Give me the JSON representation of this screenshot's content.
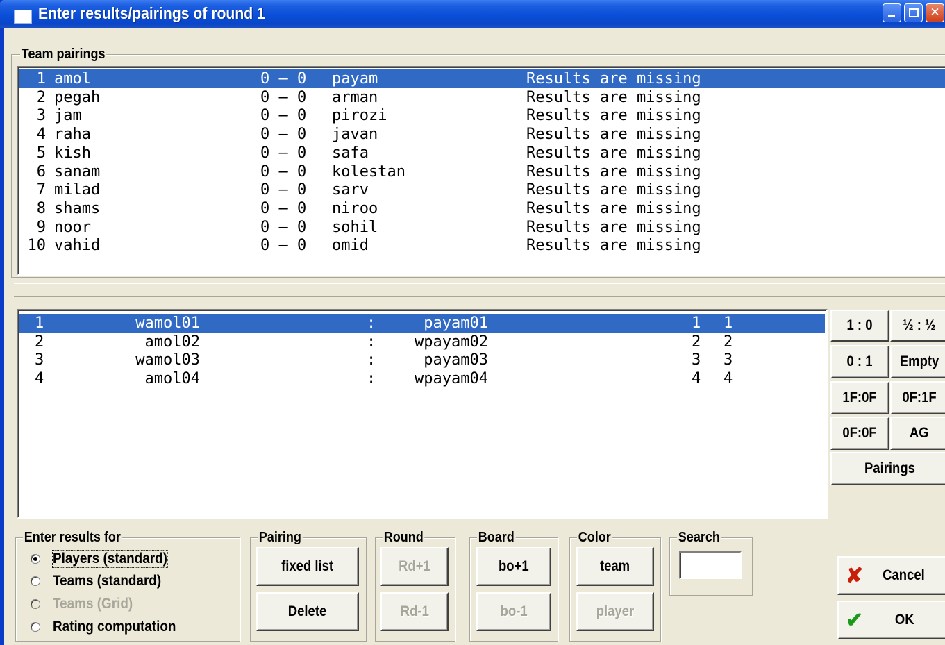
{
  "window": {
    "title": "Enter results/pairings of round 1"
  },
  "team_pairings": {
    "label": "Team pairings",
    "rows": [
      {
        "no": "1",
        "home": "amol",
        "score": "0 – 0",
        "away": "payam",
        "status": "Results are missing",
        "selected": true
      },
      {
        "no": "2",
        "home": "pegah",
        "score": "0 – 0",
        "away": "arman",
        "status": "Results are missing"
      },
      {
        "no": "3",
        "home": "jam",
        "score": "0 – 0",
        "away": "pirozi",
        "status": "Results are missing"
      },
      {
        "no": "4",
        "home": "raha",
        "score": "0 – 0",
        "away": "javan",
        "status": "Results are missing"
      },
      {
        "no": "5",
        "home": "kish",
        "score": "0 – 0",
        "away": "safa",
        "status": "Results are missing"
      },
      {
        "no": "6",
        "home": "sanam",
        "score": "0 – 0",
        "away": "kolestan",
        "status": "Results are missing"
      },
      {
        "no": "7",
        "home": "milad",
        "score": "0 – 0",
        "away": "sarv",
        "status": "Results are missing"
      },
      {
        "no": "8",
        "home": "shams",
        "score": "0 – 0",
        "away": "niroo",
        "status": "Results are missing"
      },
      {
        "no": "9",
        "home": "noor",
        "score": "0 – 0",
        "away": "sohil",
        "status": "Results are missing"
      },
      {
        "no": "10",
        "home": "vahid",
        "score": "0 – 0",
        "away": "omid",
        "status": "Results are missing"
      }
    ]
  },
  "board_pairings": {
    "rows": [
      {
        "board": "1",
        "white": "wamol01",
        "sep": ":",
        "black": "payam01",
        "n1": "1",
        "n2": "1",
        "selected": true
      },
      {
        "board": "2",
        "white": "amol02",
        "sep": ":",
        "black": "wpayam02",
        "n1": "2",
        "n2": "2"
      },
      {
        "board": "3",
        "white": "wamol03",
        "sep": ":",
        "black": "payam03",
        "n1": "3",
        "n2": "3"
      },
      {
        "board": "4",
        "white": "amol04",
        "sep": ":",
        "black": "wpayam04",
        "n1": "4",
        "n2": "4"
      }
    ]
  },
  "result_buttons": {
    "one_zero": "1 : 0",
    "half_half": "½ : ½",
    "zero_one": "0 : 1",
    "empty": "Empty",
    "forfeit_1f0f": "1F:0F",
    "forfeit_0f1f": "0F:1F",
    "forfeit_0f0f": "0F:0F",
    "ag": "AG",
    "pairings": "Pairings"
  },
  "enter_results_for": {
    "label": "Enter results for",
    "options": [
      {
        "label": "Players (standard)",
        "checked": true,
        "enabled": true
      },
      {
        "label": "Teams (standard)",
        "checked": false,
        "enabled": true
      },
      {
        "label": "Teams (Grid)",
        "checked": false,
        "enabled": false
      },
      {
        "label": "Rating computation",
        "checked": false,
        "enabled": true
      }
    ]
  },
  "pairing_group": {
    "label": "Pairing",
    "fixed_list": "fixed list",
    "delete": "Delete"
  },
  "round_group": {
    "label": "Round",
    "next": "Rd+1",
    "prev": "Rd-1"
  },
  "board_group": {
    "label": "Board",
    "next": "bo+1",
    "prev": "bo-1"
  },
  "color_group": {
    "label": "Color",
    "team": "team",
    "player": "player"
  },
  "search_group": {
    "label": "Search",
    "value": ""
  },
  "dialog_buttons": {
    "cancel": "Cancel",
    "ok": "OK"
  },
  "colors": {
    "selection": "#316ac5",
    "titlebar": "#0a4fd8",
    "cancel_icon": "#c81e0a",
    "ok_icon": "#1a9a1a"
  }
}
